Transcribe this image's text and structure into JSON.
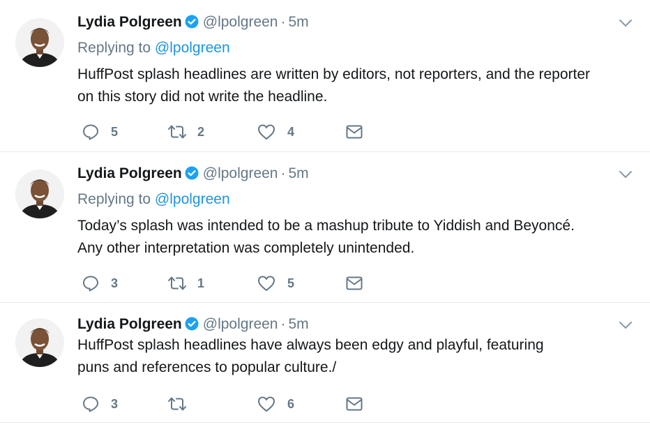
{
  "tweets": [
    {
      "author_name": "Lydia Polgreen",
      "handle": "@lpolgreen",
      "separator": "·",
      "time": "5m",
      "replying_prefix": "Replying to",
      "replying_handle": "@lpolgreen",
      "text_lines": [
        "HuffPost splash headlines are written by editors, not reporters, and the reporter",
        "on this story did not write the headline."
      ],
      "reply_count": "5",
      "retweet_count": "2",
      "like_count": "4"
    },
    {
      "author_name": "Lydia Polgreen",
      "handle": "@lpolgreen",
      "separator": "·",
      "time": "5m",
      "replying_prefix": "Replying to",
      "replying_handle": "@lpolgreen",
      "text_lines": [
        "Today’s splash was intended to be a mashup tribute to Yiddish and Beyoncé.",
        "Any other interpretation was completely unintended."
      ],
      "reply_count": "3",
      "retweet_count": "1",
      "like_count": "5"
    },
    {
      "author_name": "Lydia Polgreen",
      "handle": "@lpolgreen",
      "separator": "·",
      "time": "5m",
      "text_lines": [
        "HuffPost splash headlines have always been edgy and playful, featuring",
        "puns and references to popular culture./"
      ],
      "reply_count": "3",
      "retweet_count": "",
      "like_count": "6"
    }
  ],
  "icons": {
    "verified": "verified-badge-icon",
    "chevron": "chevron-down-icon",
    "reply": "reply-icon",
    "retweet": "retweet-icon",
    "like": "heart-icon",
    "dm": "envelope-icon"
  },
  "colors": {
    "accent": "#1da1f2",
    "link": "#1b95e0",
    "muted": "#657786",
    "text": "#14171a",
    "divider": "#e6ecf0"
  }
}
